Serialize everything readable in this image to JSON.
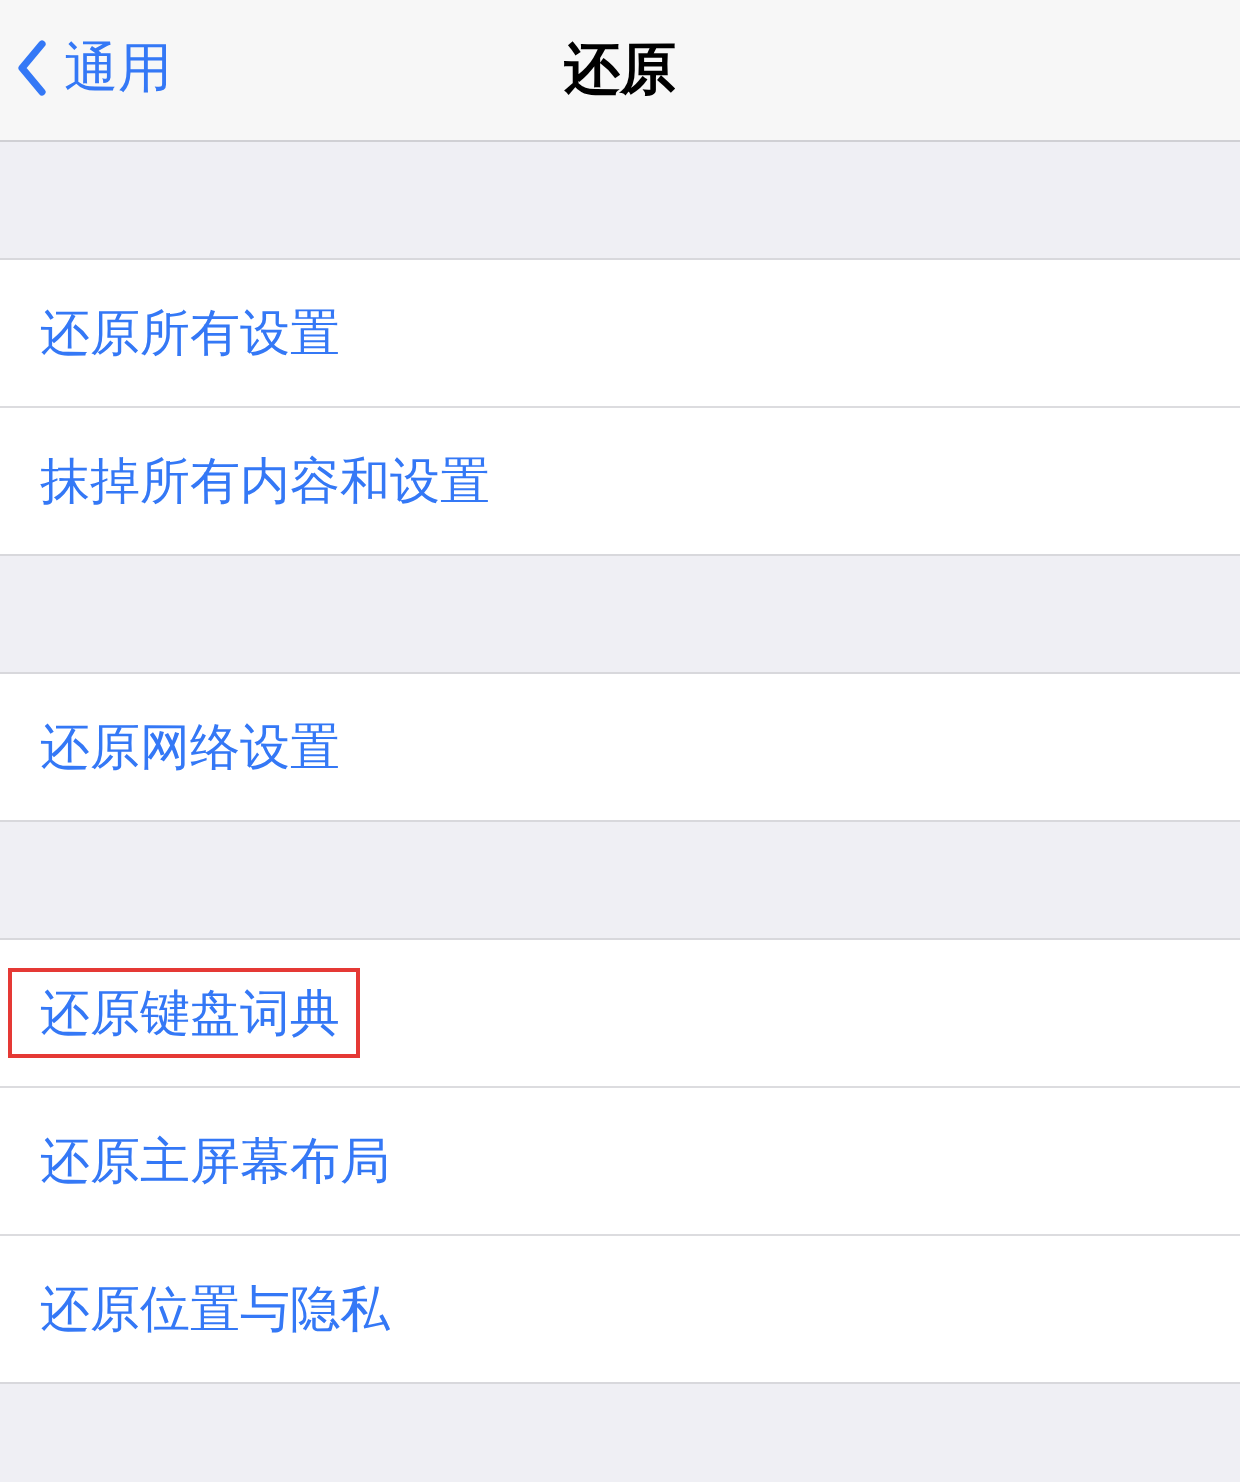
{
  "nav_bar": {
    "back_label": "通用",
    "title": "还原"
  },
  "groups": [
    {
      "items": [
        {
          "label": "还原所有设置",
          "highlighted": false
        },
        {
          "label": "抹掉所有内容和设置",
          "highlighted": false
        }
      ]
    },
    {
      "items": [
        {
          "label": "还原网络设置",
          "highlighted": false
        }
      ]
    },
    {
      "items": [
        {
          "label": "还原键盘词典",
          "highlighted": true
        },
        {
          "label": "还原主屏幕布局",
          "highlighted": false
        },
        {
          "label": "还原位置与隐私",
          "highlighted": false
        }
      ]
    }
  ]
}
